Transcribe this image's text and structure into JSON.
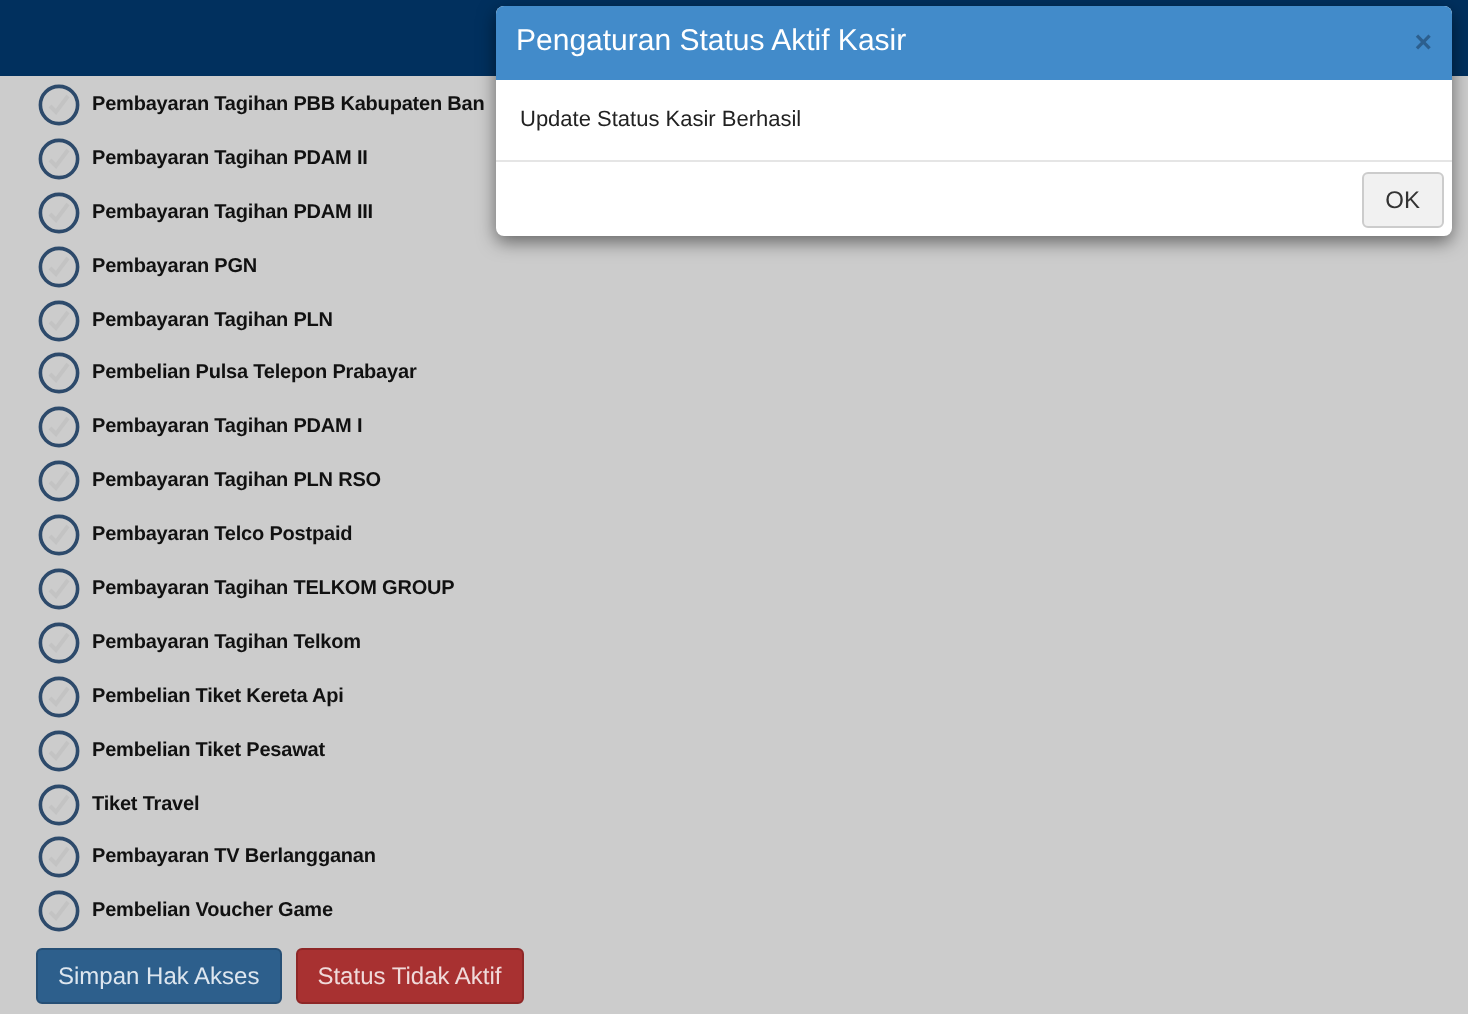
{
  "permissions": [
    {
      "label": "Pembayaran Tagihan PBB Kabupaten Ban",
      "checked": false
    },
    {
      "label": "Pembayaran Tagihan PDAM II",
      "checked": false
    },
    {
      "label": "Pembayaran Tagihan PDAM III",
      "checked": false
    },
    {
      "label": "Pembayaran PGN",
      "checked": false
    },
    {
      "label": "Pembayaran Tagihan PLN",
      "checked": false
    },
    {
      "label": "Pembelian Pulsa Telepon Prabayar",
      "checked": false
    },
    {
      "label": "Pembayaran Tagihan PDAM I",
      "checked": false
    },
    {
      "label": "Pembayaran Tagihan PLN RSO",
      "checked": false
    },
    {
      "label": "Pembayaran Telco Postpaid",
      "checked": false
    },
    {
      "label": "Pembayaran Tagihan TELKOM GROUP",
      "checked": false
    },
    {
      "label": "Pembayaran Tagihan Telkom",
      "checked": false
    },
    {
      "label": "Pembelian Tiket Kereta Api",
      "checked": false
    },
    {
      "label": "Pembelian Tiket Pesawat",
      "checked": false
    },
    {
      "label": "Tiket Travel",
      "checked": false
    },
    {
      "label": "Pembayaran TV Berlangganan",
      "checked": false
    },
    {
      "label": "Pembelian Voucher Game",
      "checked": false
    }
  ],
  "buttons": [
    {
      "label": "Simpan Hak Akses",
      "kind": "primary"
    },
    {
      "label": "Status Tidak Aktif",
      "kind": "danger"
    }
  ],
  "dialog": {
    "title": "Pengaturan Status Aktif Kasir",
    "close": "×",
    "message": "Update Status Kasir Berhasil",
    "ok": "OK"
  }
}
